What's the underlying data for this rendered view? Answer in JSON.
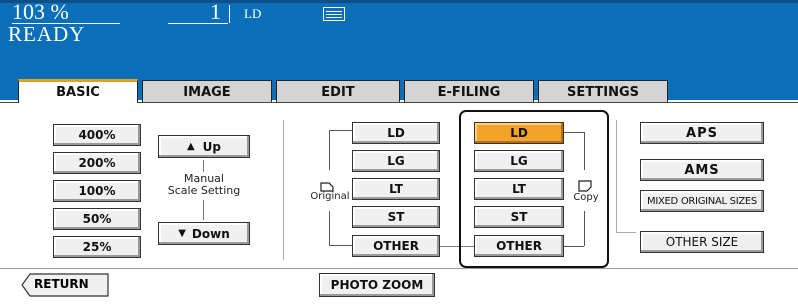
{
  "status": {
    "zoom": "103 %",
    "copies": "1",
    "paper": "LD",
    "message": "READY"
  },
  "tabs": [
    {
      "label": "BASIC",
      "active": true
    },
    {
      "label": "IMAGE",
      "active": false
    },
    {
      "label": "EDIT",
      "active": false
    },
    {
      "label": "E-FILING",
      "active": false
    },
    {
      "label": "SETTINGS",
      "active": false
    }
  ],
  "zoom_presets": [
    "400%",
    "200%",
    "100%",
    "50%",
    "25%"
  ],
  "manual": {
    "up": "Up",
    "down": "Down",
    "label_line1": "Manual",
    "label_line2": "Scale Setting"
  },
  "original": {
    "label": "Original",
    "sizes": [
      "LD",
      "LG",
      "LT",
      "ST",
      "OTHER"
    ]
  },
  "copy": {
    "label": "Copy",
    "sizes": [
      "LD",
      "LG",
      "LT",
      "ST",
      "OTHER"
    ],
    "selected": "LD"
  },
  "right_buttons": {
    "aps": "APS",
    "ams": "AMS",
    "mixed": "MIXED ORIGINAL SIZES",
    "other_size": "OTHER SIZE"
  },
  "bottom": {
    "return": "RETURN",
    "photo_zoom": "PHOTO ZOOM"
  },
  "colors": {
    "status_bar": "#0a6fb8",
    "selected": "#f3a52a",
    "active_tab_accent": "#e6a01f"
  }
}
